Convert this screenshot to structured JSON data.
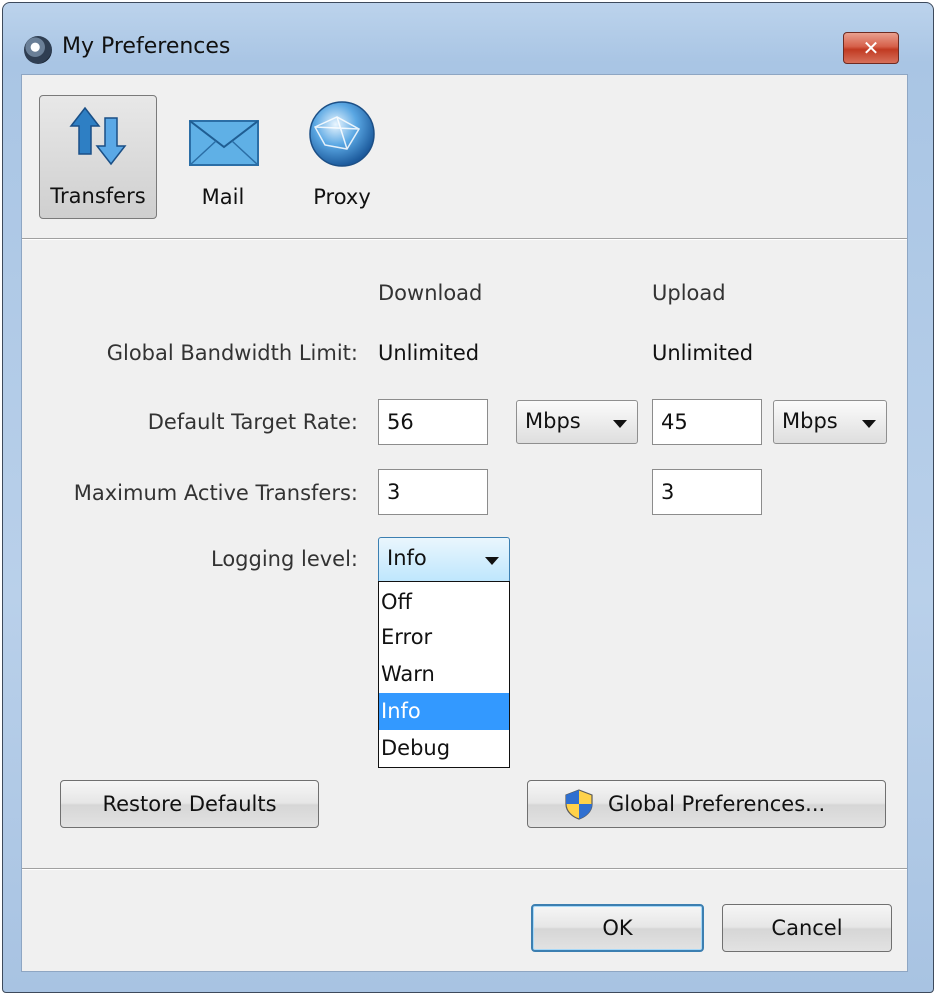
{
  "window": {
    "title": "My Preferences",
    "close_label": "✕"
  },
  "toolbar": {
    "tabs": [
      {
        "label": "Transfers",
        "icon": "transfers-arrows-icon"
      },
      {
        "label": "Mail",
        "icon": "mail-envelope-icon"
      },
      {
        "label": "Proxy",
        "icon": "proxy-globe-icon"
      }
    ],
    "selected": "Transfers"
  },
  "columns": {
    "download": "Download",
    "upload": "Upload"
  },
  "rows": {
    "bandwidth": {
      "label": "Global Bandwidth Limit:",
      "download": "Unlimited",
      "upload": "Unlimited"
    },
    "target_rate": {
      "label": "Default Target Rate:",
      "download": "56",
      "download_unit": "Mbps",
      "upload": "45",
      "upload_unit": "Mbps"
    },
    "max_active": {
      "label": "Maximum Active Transfers:",
      "download": "3",
      "upload": "3"
    },
    "logging": {
      "label": "Logging level:",
      "value": "Info",
      "options": [
        "Off",
        "Error",
        "Warn",
        "Info",
        "Debug"
      ]
    }
  },
  "buttons": {
    "restore": "Restore Defaults",
    "global": "Global Preferences...",
    "ok": "OK",
    "cancel": "Cancel"
  },
  "colors": {
    "selection": "#3399ff",
    "title_bar": "#b9d1ea",
    "close": "#c7402a"
  }
}
